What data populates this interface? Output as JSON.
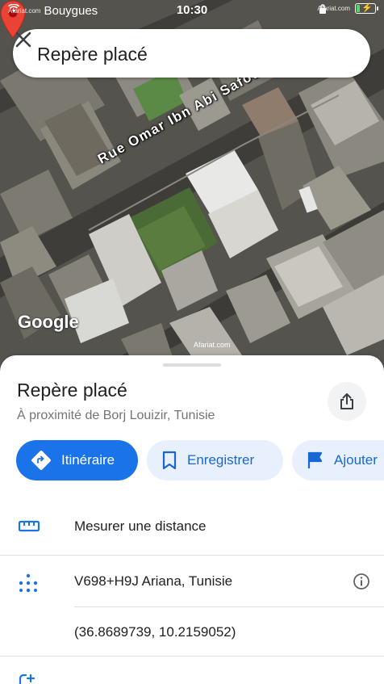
{
  "status_bar": {
    "carrier": "Bouygues",
    "time": "10:30",
    "watermark_left": "Afariat.com",
    "watermark_right": "Afariat.com",
    "battery_level": 0.2
  },
  "search": {
    "title": "Repère placé"
  },
  "map": {
    "street_label": "Rue Omar Ibn Abi Safouane",
    "logo": "Google",
    "watermark": "Afariat.com",
    "pin_color": "#ea4335"
  },
  "place": {
    "title": "Repère placé",
    "subtitle": "À proximité de Borj Louizir, Tunisie"
  },
  "actions": {
    "directions_label": "Itinéraire",
    "save_label": "Enregistrer",
    "add_label": "Ajouter"
  },
  "rows": {
    "measure_label": "Mesurer une distance",
    "plus_code": "V698+H9J Ariana, Tunisie",
    "coordinates": "(36.8689739, 10.2159052)"
  },
  "colors": {
    "accent": "#1a73e8",
    "accent_light": "#e8f0fe"
  }
}
